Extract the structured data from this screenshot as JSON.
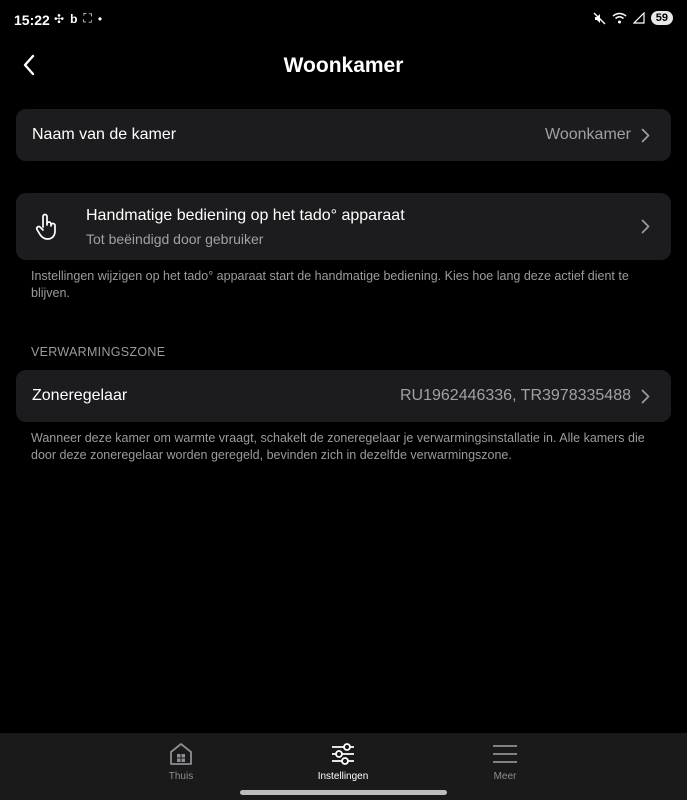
{
  "status_bar": {
    "time": "15:22",
    "left_icons": [
      "pinwheel-icon",
      "b-icon",
      "screenshot-icon",
      "dot"
    ],
    "right_icons": [
      "mute-icon",
      "wifi-icon",
      "signal-icon"
    ],
    "battery": "59"
  },
  "header": {
    "title": "Woonkamer",
    "back_icon": "chevron-left-icon"
  },
  "room_name": {
    "label": "Naam van de kamer",
    "value": "Woonkamer"
  },
  "manual_control": {
    "title": "Handmatige bediening op het tado° apparaat",
    "subtitle": "Tot beëindigd door gebruiker",
    "icon": "hand-pointer-icon",
    "note": "Instellingen wijzigen op het tado° apparaat start de handmatige bediening. Kies hoe lang deze actief dient te blijven."
  },
  "heating_zone": {
    "section_title": "VERWARMINGSZONE",
    "label": "Zoneregelaar",
    "value": "RU1962446336, TR3978335488",
    "note": "Wanneer deze kamer om warmte vraagt, schakelt de zoneregelaar je verwarmingsinstallatie in. Alle kamers die door deze zoneregelaar worden geregeld, bevinden zich in dezelfde verwarmingszone."
  },
  "bottom_nav": {
    "items": [
      {
        "label": "Thuis",
        "icon": "house-icon"
      },
      {
        "label": "Instellingen",
        "icon": "sliders-icon",
        "active": true
      },
      {
        "label": "Meer",
        "icon": "menu-icon"
      }
    ]
  },
  "colors": {
    "background": "#000000",
    "card": "#1c1c1e",
    "secondary_text": "#a0a0a5",
    "nav_background": "#1a1a1a"
  }
}
